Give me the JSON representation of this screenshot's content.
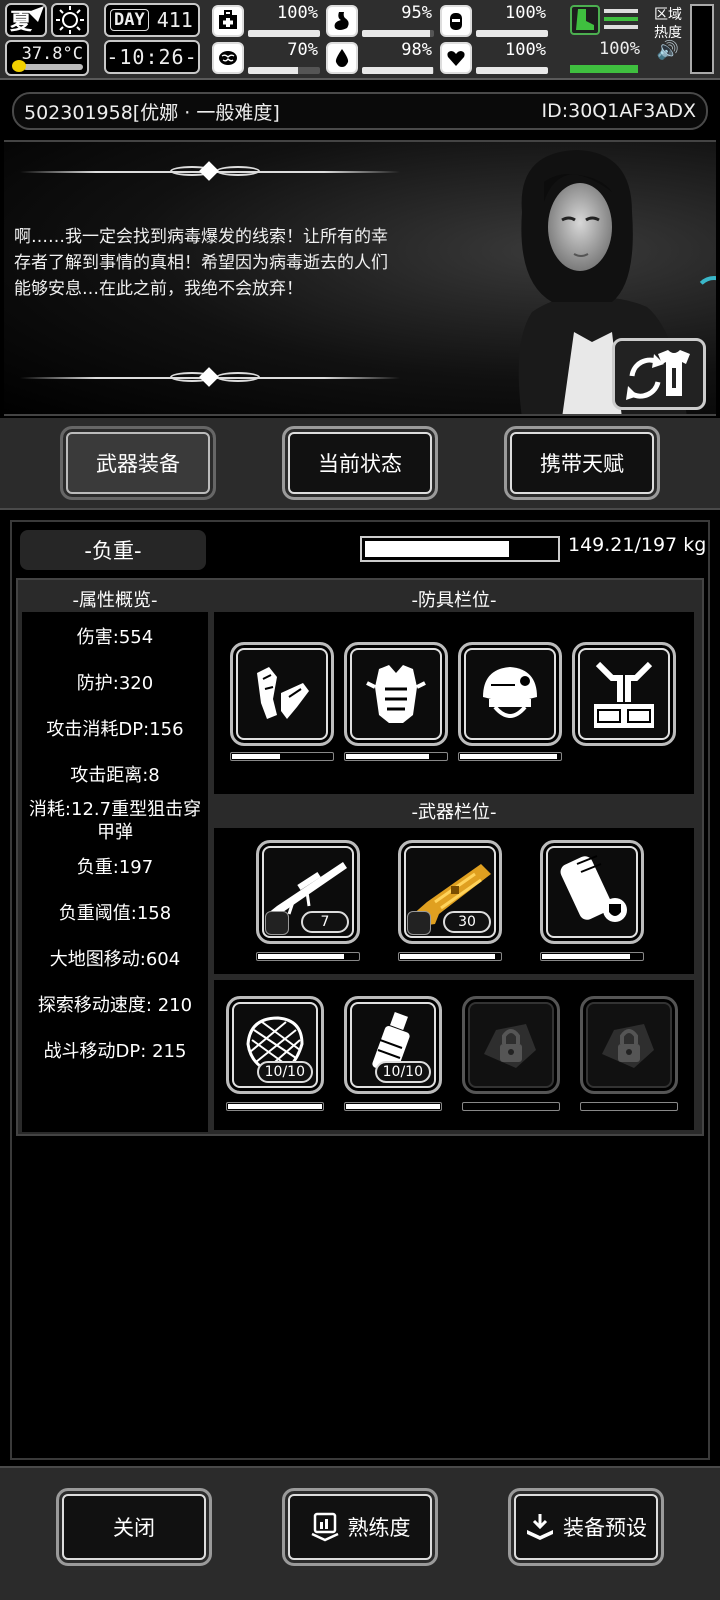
{
  "status": {
    "season": "夏",
    "temperature": "37.8°C",
    "day_tag": "DAY",
    "day": "411",
    "clock": "-10:26-",
    "stats": [
      {
        "icon": "medkit-icon",
        "value": "100%",
        "fill": 1.0
      },
      {
        "icon": "stomach-icon",
        "value": "95%",
        "fill": 0.95
      },
      {
        "icon": "canteen-icon",
        "value": "100%",
        "fill": 1.0
      },
      {
        "icon": "brain-icon",
        "value": "70%",
        "fill": 0.7
      },
      {
        "icon": "water-drop-icon",
        "value": "98%",
        "fill": 0.98
      },
      {
        "icon": "heart-icon",
        "value": "100%",
        "fill": 1.0
      }
    ],
    "stamina": {
      "value": "100%",
      "fill": 1.0
    },
    "zone_label": "区域热度",
    "zone_sound": "🔊"
  },
  "player": {
    "name": "502301958[优娜 · 一般难度]",
    "id": "ID:30Q1AF3ADX"
  },
  "dialog": {
    "text": "啊……我一定会找到病毒爆发的线索！让所有的幸存者了解到事情的真相！希望因为病毒逝去的人们能够安息…在此之前，我绝不会放弃！"
  },
  "tabs": [
    "武器装备",
    "当前状态",
    "携带天赋"
  ],
  "load": {
    "label": "-负重-",
    "value": "149.21/197 kg",
    "fill": 0.757
  },
  "sections": {
    "attributes": "-属性概览-",
    "armor": "-防具栏位-",
    "weapons": "-武器栏位-"
  },
  "attributes": [
    "伤害:554",
    "防护:320",
    "攻击消耗DP:156",
    "攻击距离:8",
    "消耗:12.7重型狙击穿甲弹",
    "负重:197",
    "负重阈值:158",
    "大地图移动:604",
    "探索移动速度: 210",
    "战斗移动DP: 215"
  ],
  "armor_slots": [
    {
      "name": "gloves",
      "durability": 0.48
    },
    {
      "name": "vest",
      "durability": 0.83
    },
    {
      "name": "helmet",
      "durability": 0.97
    },
    {
      "name": "backpack-frame",
      "durability": null
    }
  ],
  "weapon_slots": [
    {
      "name": "sniper-rifle",
      "badge": "7",
      "durability": 0.86
    },
    {
      "name": "gold-shotgun",
      "badge": "30",
      "durability": 0.95
    },
    {
      "name": "shield-case",
      "badge": "",
      "durability": 0.88
    }
  ],
  "item_slots": [
    {
      "name": "net-trap",
      "badge": "10/10",
      "durability": 1.0,
      "locked": false
    },
    {
      "name": "grenade",
      "badge": "10/10",
      "durability": 1.0,
      "locked": false
    },
    {
      "name": "locked-slot",
      "badge": "",
      "durability": 0,
      "locked": true
    },
    {
      "name": "locked-slot",
      "badge": "",
      "durability": 0,
      "locked": true
    }
  ],
  "bottom_buttons": [
    "关闭",
    "熟练度",
    "装备预设"
  ]
}
